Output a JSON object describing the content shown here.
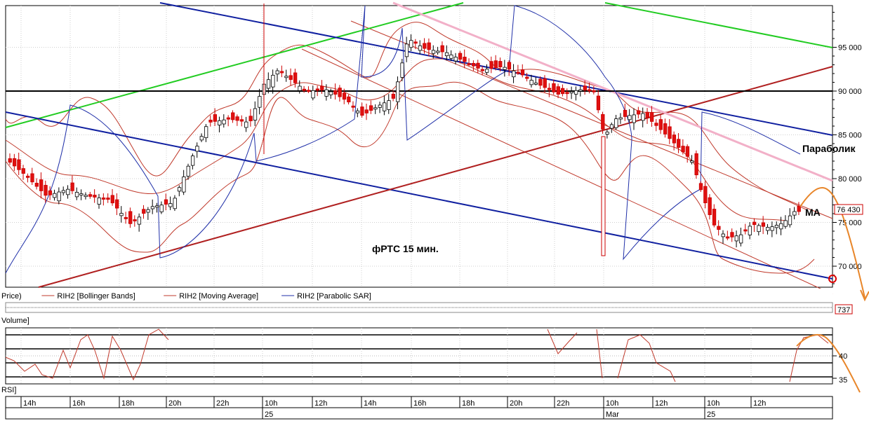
{
  "chart_data": {
    "type": "candlestick",
    "main_panel": {
      "annotation": "фРТС   15 мин.",
      "y_ticks": [
        "95 000",
        "90 000",
        "85 000",
        "80 000",
        "75 000",
        "70 000"
      ],
      "y_tick_values": [
        95000,
        90000,
        85000,
        80000,
        75000,
        70000
      ],
      "ylim": [
        67700,
        100200
      ],
      "last_price_label": "76 430",
      "last_price": 76430,
      "parabolic_label": "Параболик",
      "ma_label": "MA",
      "legend": [
        {
          "name": "Price)",
          "color": "#000000",
          "line": false
        },
        {
          "name": "RIH2 [Bollinger Bands]",
          "color": "#c0392b",
          "line": true
        },
        {
          "name": "RIH2 [Moving Average]",
          "color": "#c0392b",
          "line": true
        },
        {
          "name": "RIH2 [Parabolic SAR]",
          "color": "#1f2fa8",
          "line": true
        }
      ],
      "hlines": [
        90000
      ]
    },
    "volume_panel": {
      "label": "Volume]",
      "value_label": "737"
    },
    "rsi_panel": {
      "label": "RSI]",
      "y_ticks": [
        "40",
        "35"
      ]
    },
    "x_axis": {
      "hour_ticks": [
        "14h",
        "16h",
        "18h",
        "20h",
        "22h",
        "10h",
        "12h",
        "14h",
        "16h",
        "18h",
        "20h",
        "22h",
        "10h",
        "12h",
        "10h",
        "12h"
      ],
      "date_labels": [
        "25",
        "Mar",
        "25"
      ]
    },
    "colors": {
      "bull": "#ffffff",
      "bear": "#e01010",
      "bollinger": "#c0392b",
      "sar": "#1f2fa8",
      "trend_green": "#22cc22",
      "trend_blue": "#1020a0",
      "trend_red": "#b02020",
      "trend_pink": "#f2b0c8",
      "forecast": "#e8862a"
    }
  }
}
